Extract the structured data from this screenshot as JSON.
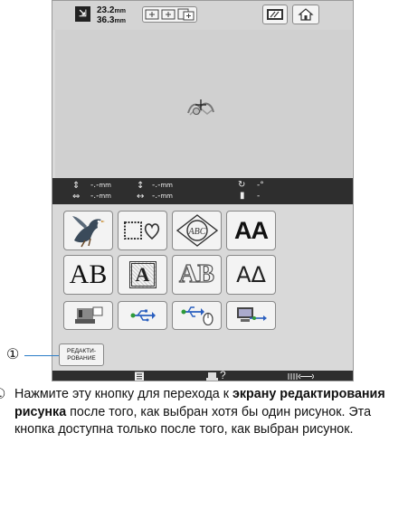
{
  "screen": {
    "size": {
      "width": "23.2",
      "height": "36.3",
      "unit": "mm"
    },
    "status": {
      "height_value": "-.-",
      "width_value": "-.-",
      "vertical_offset": "-.-",
      "horizontal_offset": "-.-",
      "unit": "mm",
      "rotation_value": "-",
      "rotation_unit": "°",
      "thread_value": "-"
    },
    "grid_buttons": [
      {
        "name": "pattern-bird-button",
        "text": ""
      },
      {
        "name": "frame-pattern-button",
        "text": ""
      },
      {
        "name": "monogram-button",
        "text": "ABC"
      },
      {
        "name": "font-aa-button",
        "text": "AA"
      },
      {
        "name": "font-ab-serif-button",
        "text": "AB"
      },
      {
        "name": "decorative-letter-button",
        "text": "A"
      },
      {
        "name": "outline-font-button",
        "text": "AB"
      },
      {
        "name": "font-aa-triangle-button",
        "text": "AΔ"
      }
    ],
    "edit_button": {
      "line1": "РЕДАКТИ-",
      "line2": "РОВАНИЕ"
    },
    "bottom": {
      "help_text": "?"
    }
  },
  "callout": {
    "number": "①"
  },
  "caption": {
    "number": "①",
    "part1": "Нажмите эту кнопку для перехода к ",
    "bold": "экрану редактирования рисунка",
    "part2": " после того, как выбран хотя бы один рисунок. Эта кнопка доступна только после того, как выбран рисунок."
  },
  "colors": {
    "panel": "#d9d9d9",
    "statusbar": "#2e2e2e",
    "callout_line": "#2a7dc8",
    "green_icon": "#2e9a3a",
    "blue_icon": "#2a5fbf"
  }
}
